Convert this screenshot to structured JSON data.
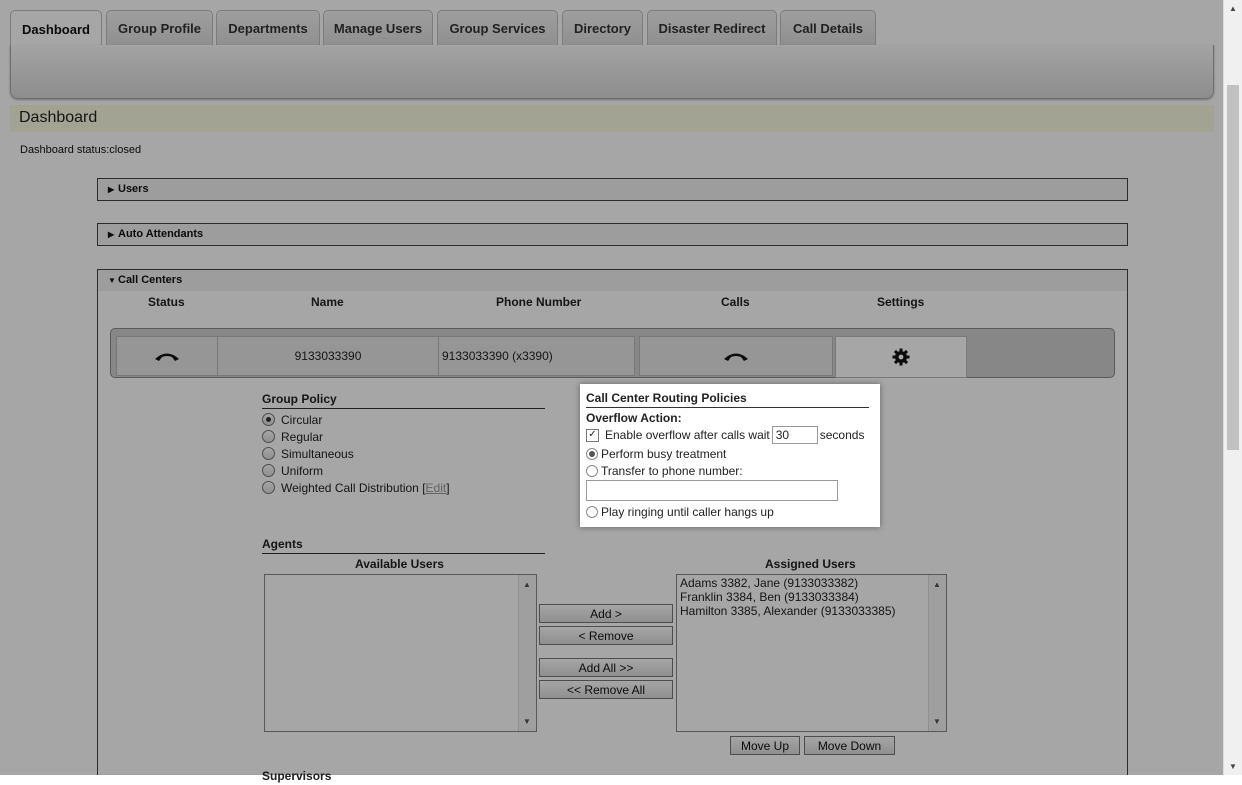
{
  "tabs": [
    "Dashboard",
    "Group Profile",
    "Departments",
    "Manage Users",
    "Group Services",
    "Directory",
    "Disaster Redirect",
    "Call Details"
  ],
  "page_title": "Dashboard",
  "dashboard_status": "Dashboard status:closed",
  "panels": {
    "users": "Users",
    "auto_attendants": "Auto Attendants",
    "call_centers": "Call Centers"
  },
  "columns": {
    "status": "Status",
    "name": "Name",
    "phone_number": "Phone Number",
    "calls": "Calls",
    "settings": "Settings"
  },
  "call_center_row": {
    "name": "9133033390",
    "phone_number": "9133033390 (x3390)"
  },
  "group_policy": {
    "heading": "Group Policy",
    "options": [
      "Circular",
      "Regular",
      "Simultaneous",
      "Uniform",
      "Weighted Call Distribution"
    ],
    "selected": "Circular",
    "edit_open": "[",
    "edit_label": "Edit",
    "edit_close": "]"
  },
  "routing_policies": {
    "heading": "Call Center Routing Policies",
    "overflow_heading": "Overflow Action:",
    "enable_label": "Enable overflow after calls wait",
    "enable_checked": true,
    "wait_seconds": "30",
    "seconds_label": "seconds",
    "busy_label": "Perform busy treatment",
    "transfer_label": "Transfer to phone number:",
    "transfer_value": "",
    "ringing_label": "Play ringing until caller hangs up",
    "selected": "Perform busy treatment"
  },
  "agents": {
    "heading": "Agents",
    "available_label": "Available Users",
    "assigned_label": "Assigned Users",
    "available": [],
    "assigned": [
      "Adams 3382, Jane (9133033382)",
      "Franklin 3384, Ben (9133033384)",
      "Hamilton 3385, Alexander (9133033385)"
    ],
    "add": "Add >",
    "remove": "< Remove",
    "add_all": "Add All >>",
    "remove_all": "<< Remove All",
    "move_up": "Move Up",
    "move_down": "Move Down"
  },
  "supervisors_heading": "Supervisors",
  "icons": {
    "status": "phone-handset-icon",
    "calls": "phone-handset-icon",
    "settings": "gear-icon"
  }
}
